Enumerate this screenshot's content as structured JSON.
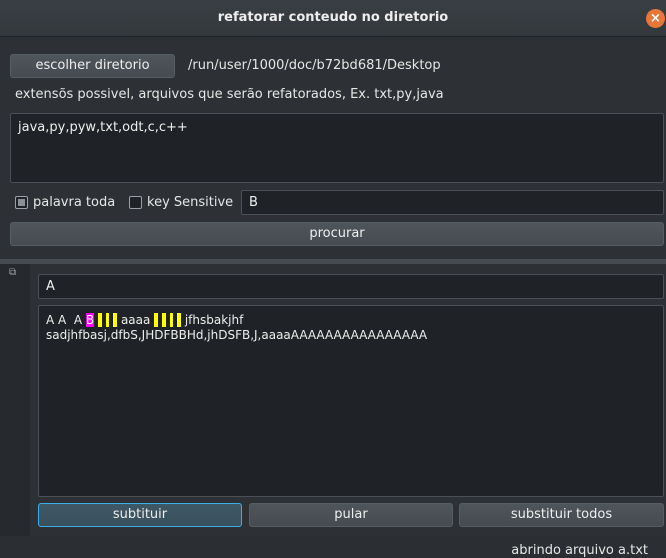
{
  "window": {
    "title": "refatorar conteudo no diretorio"
  },
  "top": {
    "choose_dir_label": "escolher diretorio",
    "dir_path": "/run/user/1000/doc/b72bd681/Desktop",
    "extensions_hint": "extensõs possivel, arquivos que serão refatorados, Ex. txt,py,java",
    "extensions_value": "java,py,pyw,txt,odt,c,c++",
    "whole_word_label": "palavra toda",
    "whole_word_checked": true,
    "case_sensitive_label": "key Sensitive",
    "case_sensitive_checked": false,
    "search_value": "B",
    "search_button": "procurar"
  },
  "bottom": {
    "replace_value": "A",
    "editor": {
      "line1_parts": [
        "A A  A",
        "B",
        "",
        "",
        "",
        "",
        "aaaa",
        "",
        "",
        "",
        "",
        "jfhsbakjhf"
      ],
      "line2": "sadjhfbasj,dfbS,JHDFBBHd,jhDSFB,J,aaaaAAAAAAAAAAAAAAAA"
    },
    "replace_button": "subtituir",
    "skip_button": "pular",
    "replace_all_button": "substituir todos"
  },
  "status": {
    "message": "abrindo arquivo a.txt"
  },
  "colors": {
    "accent": "#3daee9",
    "close": "#e8773a",
    "match_current": "#ff00ff",
    "match_other": "#ffff00"
  }
}
